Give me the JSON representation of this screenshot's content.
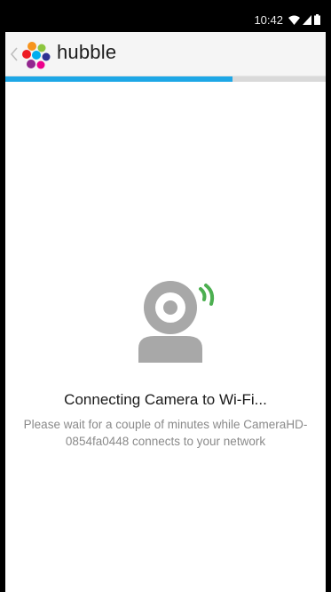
{
  "status_bar": {
    "time": "10:42"
  },
  "app_bar": {
    "brand": "hubble"
  },
  "setup_progress": {
    "fraction": 0.71
  },
  "main": {
    "title": "Connecting Camera to Wi-Fi...",
    "message": "Please wait for a couple of minutes while CameraHD-0854fa0448 connects to your network"
  },
  "colors": {
    "accent": "#1ea7e6",
    "progress_track": "#d9d9d9",
    "camera_gray": "#a8a8a8",
    "signal_green": "#4caf50"
  },
  "icons": [
    "wifi-icon",
    "cell-signal-icon",
    "battery-icon",
    "back-chevron-icon",
    "hubble-logo-icon",
    "camera-icon",
    "connecting-signal-icon"
  ]
}
